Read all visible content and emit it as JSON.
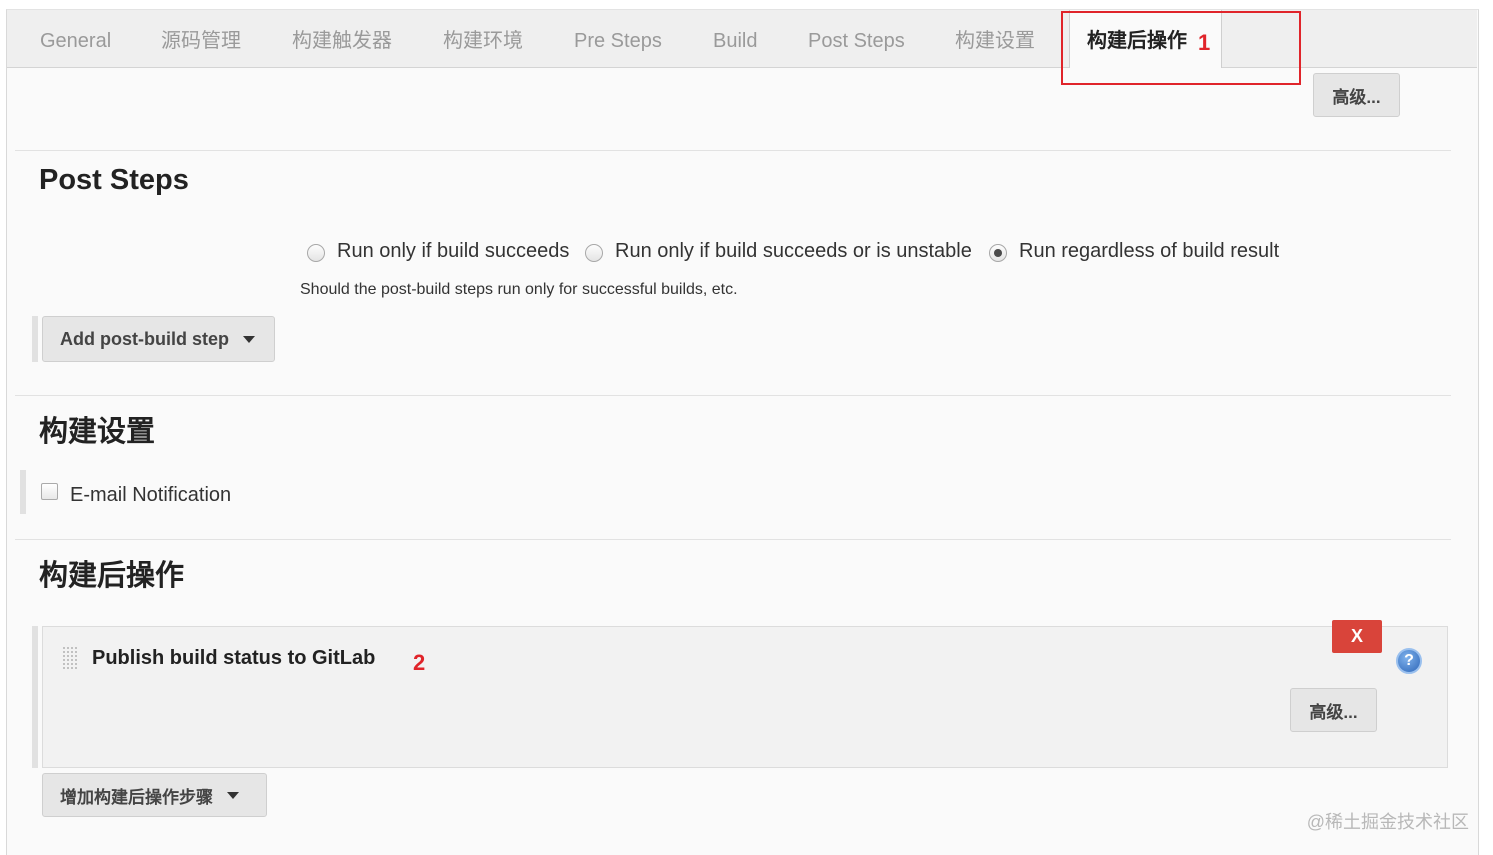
{
  "tabs": [
    {
      "label": "General"
    },
    {
      "label": "源码管理"
    },
    {
      "label": "构建触发器"
    },
    {
      "label": "构建环境"
    },
    {
      "label": "Pre Steps"
    },
    {
      "label": "Build"
    },
    {
      "label": "Post Steps"
    },
    {
      "label": "构建设置"
    },
    {
      "label": "构建后操作"
    }
  ],
  "annotations": {
    "first": "1",
    "second": "2"
  },
  "advanced_label": "高级...",
  "post_steps": {
    "title": "Post Steps",
    "options": [
      {
        "label": "Run only if build succeeds",
        "checked": false
      },
      {
        "label": "Run only if build succeeds or is unstable",
        "checked": false
      },
      {
        "label": "Run regardless of build result",
        "checked": true
      }
    ],
    "hint": "Should the post-build steps run only for successful builds, etc.",
    "add_button": "Add post-build step"
  },
  "build_settings": {
    "title": "构建设置",
    "email_label": "E-mail Notification",
    "email_checked": false
  },
  "post_build": {
    "title": "构建后操作",
    "action_title": "Publish build status to GitLab",
    "delete_label": "X",
    "help_label": "?",
    "advanced_label": "高级...",
    "add_button": "增加构建后操作步骤"
  },
  "watermark": "@稀土掘金技术社区",
  "colors": {
    "annotation": "#e0242a",
    "delete": "#d9443a",
    "help": "#2d66b8"
  }
}
